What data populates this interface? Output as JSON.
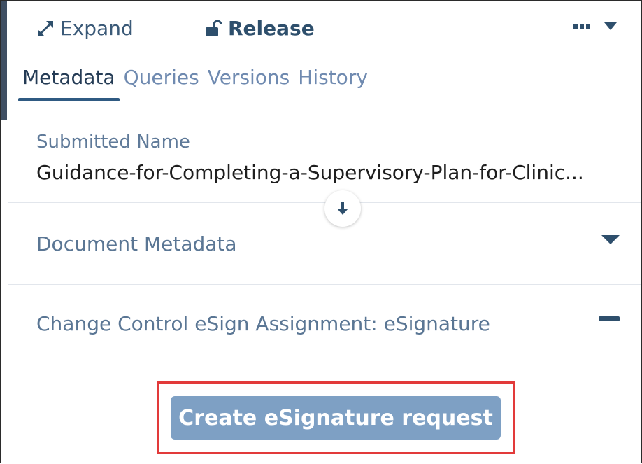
{
  "toolbar": {
    "expand_label": "Expand",
    "release_label": "Release"
  },
  "tabs": [
    {
      "label": "Metadata",
      "active": true
    },
    {
      "label": "Queries",
      "active": false
    },
    {
      "label": "Versions",
      "active": false
    },
    {
      "label": "History",
      "active": false
    }
  ],
  "submitted": {
    "label": "Submitted Name",
    "value": "Guidance-for-Completing-a-Supervisory-Plan-for-Clinic..."
  },
  "sections": {
    "document_metadata": "Document Metadata",
    "esign_assignment": "Change Control eSign Assignment: eSignature"
  },
  "actions": {
    "create_esignature": "Create eSignature request"
  },
  "colors": {
    "accent": "#2f5a82",
    "tab_inactive": "#6f8ab0",
    "button_bg": "#7ea0c4",
    "highlight": "#e23a3a"
  },
  "icons": {
    "expand": "expand-arrows-icon",
    "release": "unlock-icon",
    "more": "more-horizontal-icon",
    "dropdown": "caret-down-icon",
    "collapse": "arrow-down-icon",
    "section_open": "minus-icon"
  }
}
